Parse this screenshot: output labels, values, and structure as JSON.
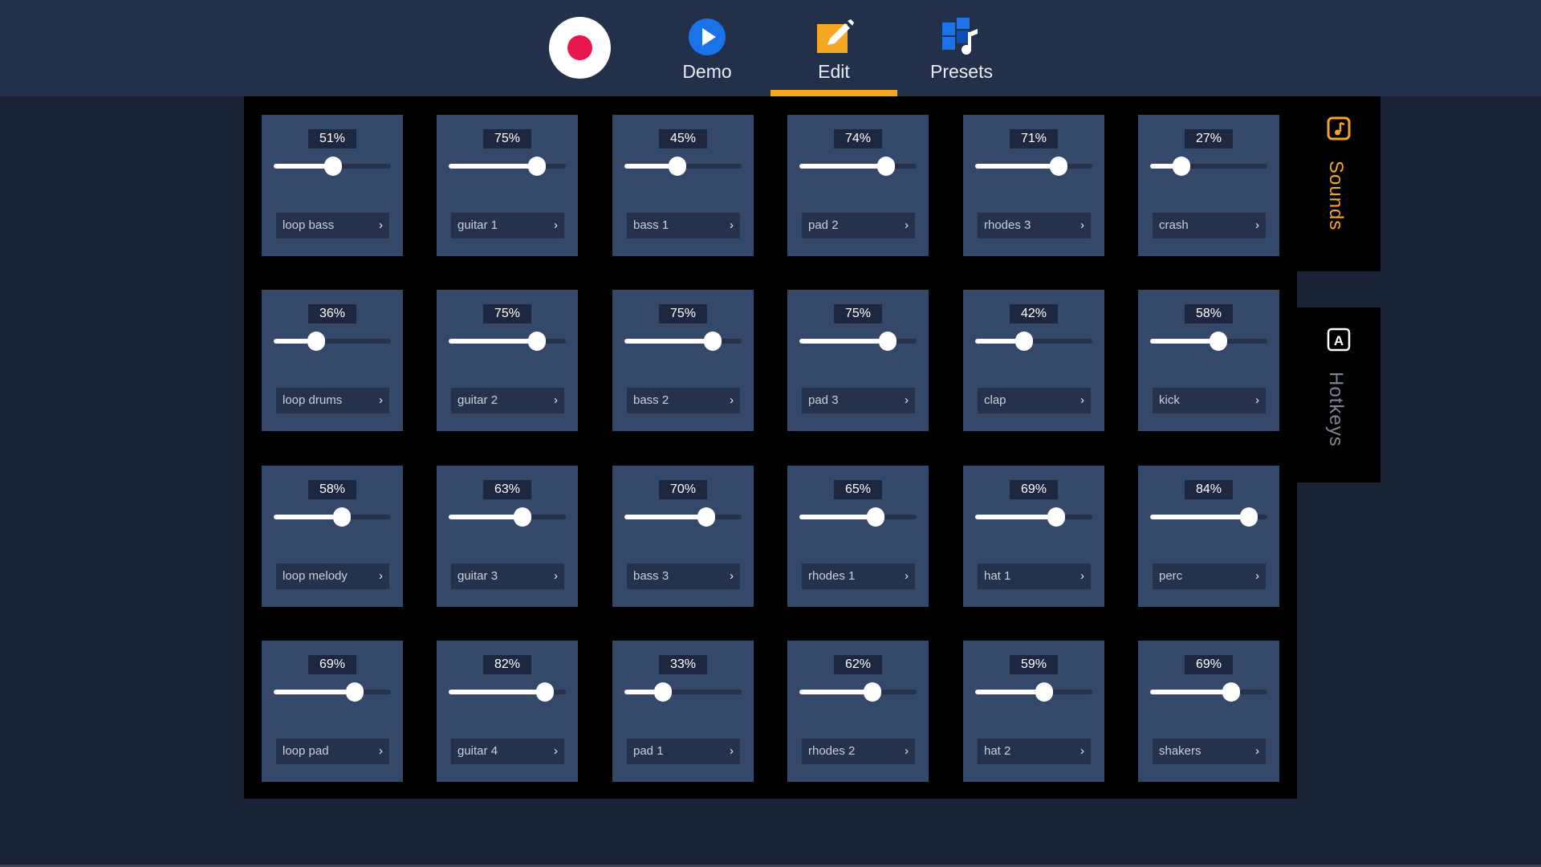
{
  "colors": {
    "accent": "#f5a623",
    "record": "#e8164a",
    "demo_icon": "#1a73e8",
    "pad_bg": "#34486a",
    "panel_bg": "#000000"
  },
  "nav": {
    "demo_label": "Demo",
    "edit_label": "Edit",
    "presets_label": "Presets",
    "active_tab": "Edit"
  },
  "side_tabs": {
    "sounds_label": "Sounds",
    "hotkeys_label": "Hotkeys",
    "hotkeys_icon_letter": "A",
    "active": "Sounds"
  },
  "pads": [
    {
      "volume": "51%",
      "level": 51,
      "sound": "loop bass"
    },
    {
      "volume": "75%",
      "level": 75,
      "sound": "guitar 1"
    },
    {
      "volume": "45%",
      "level": 45,
      "sound": "bass 1"
    },
    {
      "volume": "74%",
      "level": 74,
      "sound": "pad 2"
    },
    {
      "volume": "71%",
      "level": 71,
      "sound": "rhodes 3"
    },
    {
      "volume": "27%",
      "level": 27,
      "sound": "crash"
    },
    {
      "volume": "36%",
      "level": 36,
      "sound": "loop drums"
    },
    {
      "volume": "75%",
      "level": 75,
      "sound": "guitar 2"
    },
    {
      "volume": "75%",
      "level": 75,
      "sound": "bass 2"
    },
    {
      "volume": "75%",
      "level": 75,
      "sound": "pad 3"
    },
    {
      "volume": "42%",
      "level": 42,
      "sound": "clap"
    },
    {
      "volume": "58%",
      "level": 58,
      "sound": "kick"
    },
    {
      "volume": "58%",
      "level": 58,
      "sound": "loop melody"
    },
    {
      "volume": "63%",
      "level": 63,
      "sound": "guitar 3"
    },
    {
      "volume": "70%",
      "level": 70,
      "sound": "bass 3"
    },
    {
      "volume": "65%",
      "level": 65,
      "sound": "rhodes 1"
    },
    {
      "volume": "69%",
      "level": 69,
      "sound": "hat 1"
    },
    {
      "volume": "84%",
      "level": 84,
      "sound": "perc"
    },
    {
      "volume": "69%",
      "level": 69,
      "sound": "loop pad"
    },
    {
      "volume": "82%",
      "level": 82,
      "sound": "guitar 4"
    },
    {
      "volume": "33%",
      "level": 33,
      "sound": "pad 1"
    },
    {
      "volume": "62%",
      "level": 62,
      "sound": "rhodes 2"
    },
    {
      "volume": "59%",
      "level": 59,
      "sound": "hat 2"
    },
    {
      "volume": "69%",
      "level": 69,
      "sound": "shakers"
    }
  ]
}
